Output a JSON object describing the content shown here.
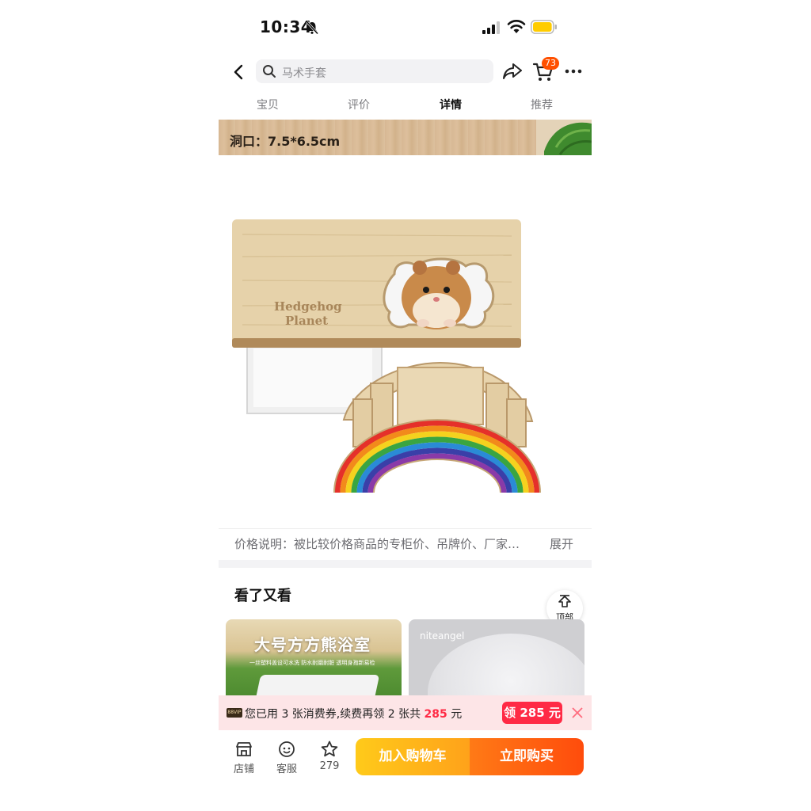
{
  "status_bar": {
    "time": "10:34"
  },
  "nav": {
    "search_placeholder": "马术手套",
    "cart_count": "73"
  },
  "tabs": [
    {
      "label": "宝贝"
    },
    {
      "label": "评价"
    },
    {
      "label": "详情"
    },
    {
      "label": "推荐"
    }
  ],
  "active_tab": "详情",
  "banner": {
    "text": "洞口：7.5*6.5cm"
  },
  "product_image": {
    "brand_line1": "Hedgehog",
    "brand_line2": "Planet"
  },
  "price_note": {
    "text": "价格说明：被比较价格商品的专柜价、吊牌价、厂家…",
    "expand_label": "展开"
  },
  "see_also": {
    "title": "看了又看",
    "back_to_top_label": "顶部",
    "cards": [
      {
        "title": "大号方方熊浴室",
        "subtitle": "一丝塑料盖设可水洗     防水耐磨耐脏     透明身孢新易检"
      },
      {
        "logo": "niteangel"
      }
    ]
  },
  "coupon": {
    "vip_badge": "88VIP",
    "text_prefix": "您已用 3 张消费券,续费再领 2 张共 ",
    "amount": "285",
    "text_suffix": " 元",
    "button_label": "领 285 元"
  },
  "bottom_bar": {
    "store_label": "店铺",
    "service_label": "客服",
    "favorites_count": "279",
    "add_to_cart_label": "加入购物车",
    "buy_now_label": "立即购买"
  },
  "colors": {
    "accent": "#ff5000",
    "coupon_red": "#ff2a45",
    "cart_yellow": "#ffb51a",
    "buy_orange": "#ff5a10"
  }
}
